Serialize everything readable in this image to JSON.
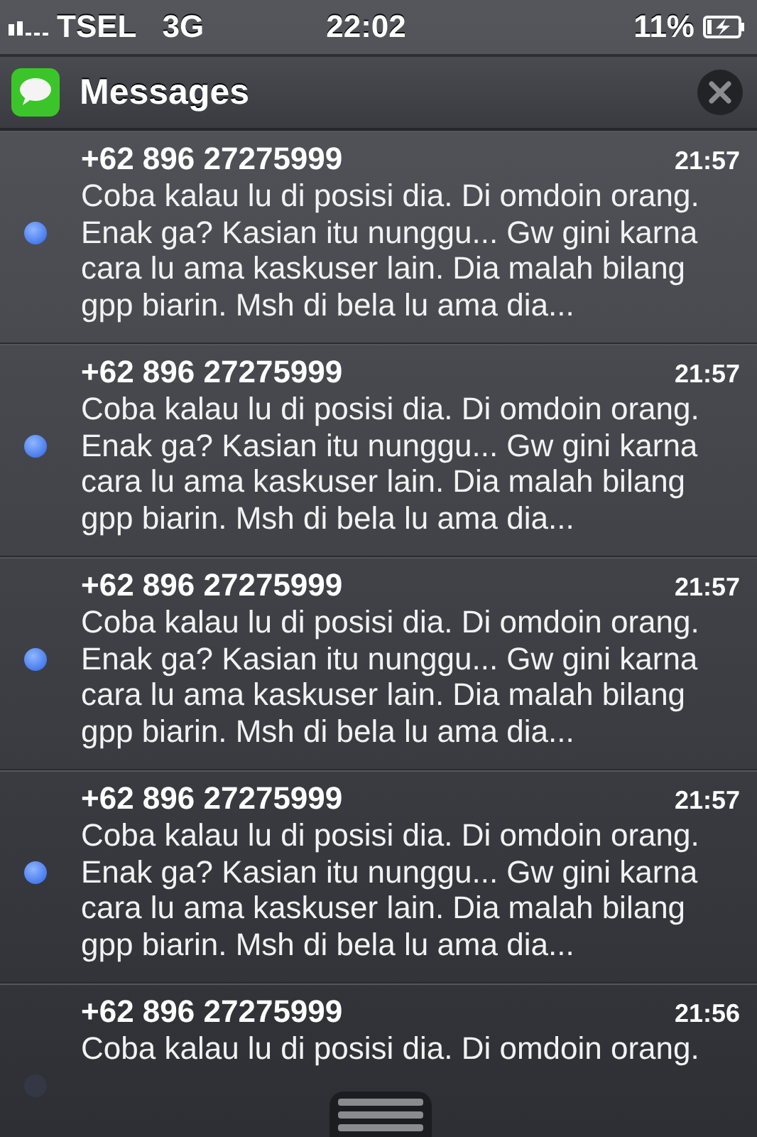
{
  "status_bar": {
    "carrier": "TSEL",
    "network": "3G",
    "time": "22:02",
    "battery": "11%",
    "charging": true
  },
  "header": {
    "title": "Messages"
  },
  "notifications": [
    {
      "sender": "+62 896 27275999",
      "time": "21:57",
      "unread": true,
      "text": "Coba kalau lu di posisi dia. Di omdoin orang. Enak ga? Kasian itu nunggu... Gw gini karna cara lu ama kaskuser lain. Dia malah bilang gpp biarin. Msh di bela lu ama dia..."
    },
    {
      "sender": "+62 896 27275999",
      "time": "21:57",
      "unread": true,
      "text": "Coba kalau lu di posisi dia. Di omdoin orang. Enak ga? Kasian itu nunggu... Gw gini karna cara lu ama kaskuser lain. Dia malah bilang gpp biarin. Msh di bela lu ama dia..."
    },
    {
      "sender": "+62 896 27275999",
      "time": "21:57",
      "unread": true,
      "text": "Coba kalau lu di posisi dia. Di omdoin orang. Enak ga? Kasian itu nunggu... Gw gini karna cara lu ama kaskuser lain. Dia malah bilang gpp biarin. Msh di bela lu ama dia..."
    },
    {
      "sender": "+62 896 27275999",
      "time": "21:57",
      "unread": true,
      "text": "Coba kalau lu di posisi dia. Di omdoin orang. Enak ga? Kasian itu nunggu... Gw gini karna cara lu ama kaskuser lain. Dia malah bilang gpp biarin. Msh di bela lu ama dia..."
    },
    {
      "sender": "+62 896 27275999",
      "time": "21:56",
      "unread": false,
      "text": "Coba kalau lu di posisi dia. Di omdoin orang."
    }
  ]
}
